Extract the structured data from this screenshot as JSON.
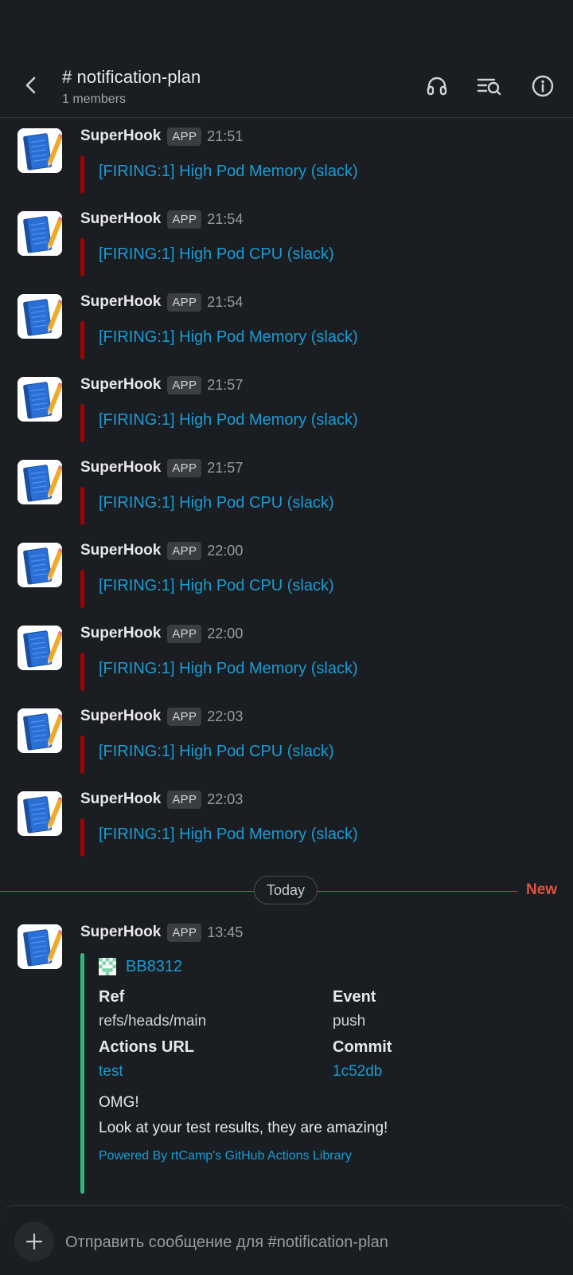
{
  "header": {
    "channel_title": "# notification-plan",
    "members": "1 members"
  },
  "messages": [
    {
      "sender": "SuperHook",
      "badge": "APP",
      "time": "21:51",
      "text": "[FIRING:1] High Pod Memory (slack)"
    },
    {
      "sender": "SuperHook",
      "badge": "APP",
      "time": "21:54",
      "text": "[FIRING:1] High Pod CPU (slack)"
    },
    {
      "sender": "SuperHook",
      "badge": "APP",
      "time": "21:54",
      "text": "[FIRING:1] High Pod Memory (slack)"
    },
    {
      "sender": "SuperHook",
      "badge": "APP",
      "time": "21:57",
      "text": "[FIRING:1] High Pod Memory (slack)"
    },
    {
      "sender": "SuperHook",
      "badge": "APP",
      "time": "21:57",
      "text": "[FIRING:1] High Pod CPU (slack)"
    },
    {
      "sender": "SuperHook",
      "badge": "APP",
      "time": "22:00",
      "text": "[FIRING:1] High Pod CPU (slack)"
    },
    {
      "sender": "SuperHook",
      "badge": "APP",
      "time": "22:00",
      "text": "[FIRING:1] High Pod Memory (slack)"
    },
    {
      "sender": "SuperHook",
      "badge": "APP",
      "time": "22:03",
      "text": "[FIRING:1] High Pod CPU (slack)"
    },
    {
      "sender": "SuperHook",
      "badge": "APP",
      "time": "22:03",
      "text": "[FIRING:1] High Pod Memory (slack)"
    }
  ],
  "divider": {
    "day_label": "Today",
    "new_label": "New"
  },
  "last_message": {
    "sender": "SuperHook",
    "badge": "APP",
    "time": "13:45",
    "attachment": {
      "author": "BB8312",
      "fields": [
        {
          "title": "Ref",
          "value": "refs/heads/main"
        },
        {
          "title": "Event",
          "value": "push"
        },
        {
          "title": "Actions URL",
          "value": "test"
        },
        {
          "title": "Commit",
          "value": "1c52db"
        }
      ],
      "title_line": "OMG!",
      "body": "Look at your test results, they are amazing!",
      "footer": "Powered By rtCamp's GitHub Actions Library"
    }
  },
  "composer": {
    "placeholder": "Отправить сообщение для #notification-plan"
  },
  "colors": {
    "background": "#1a1d21",
    "link": "#1d9bd1",
    "alert_bar": "#a30200",
    "success_bar": "#2eb67d",
    "new_divider": "#d2473a"
  },
  "icons": {
    "back": "chevron-left-icon",
    "headphones": "headphones-icon",
    "search": "search-list-icon",
    "info": "info-icon",
    "avatar": "notebook-pencil-icon",
    "add": "plus-icon"
  }
}
